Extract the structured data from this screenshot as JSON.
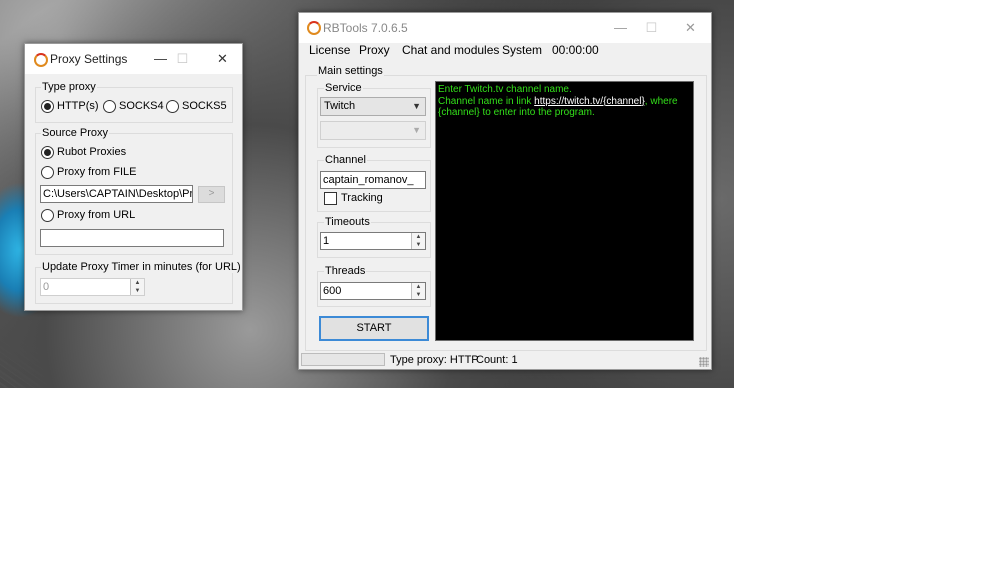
{
  "proxy_window": {
    "title": "Proxy Settings",
    "controls": {
      "minimize": "—",
      "maximize": "☐",
      "close": "✕"
    },
    "type_proxy": {
      "label": "Type proxy",
      "options": [
        "HTTP(s)",
        "SOCKS4",
        "SOCKS5"
      ],
      "selected": "HTTP(s)"
    },
    "source_proxy": {
      "label": "Source Proxy",
      "rubot_label": "Rubot Proxies",
      "file_label": "Proxy from FILE",
      "file_path": "C:\\Users\\CAPTAIN\\Desktop\\Proxy",
      "browse_label": ">",
      "url_label": "Proxy from URL",
      "url_value": "",
      "selected": "Rubot Proxies"
    },
    "update_timer": {
      "label": "Update Proxy Timer in minutes (for URL)",
      "value": "0"
    }
  },
  "rbtools_window": {
    "title": "RBTools 7.0.6.5",
    "controls": {
      "minimize": "—",
      "maximize": "☐",
      "close": "✕"
    },
    "menu": {
      "license": "License",
      "proxy": "Proxy",
      "chat": "Chat and modules",
      "system": "System",
      "timer": "00:00:00"
    },
    "main_settings_label": "Main settings",
    "service": {
      "label": "Service",
      "selected": "Twitch",
      "secondary": ""
    },
    "channel": {
      "label": "Channel",
      "value": "captain_romanov_",
      "tracking_label": "Tracking",
      "tracking_checked": false
    },
    "timeouts": {
      "label": "Timeouts",
      "value": "1"
    },
    "threads": {
      "label": "Threads",
      "value": "600"
    },
    "start_label": "START",
    "console": {
      "line1": "Enter Twitch.tv channel name.",
      "line2_prefix": "Channel name in link ",
      "line2_link": "https://twitch.tv/{channel}",
      "line2_suffix": ", where",
      "line3": "{channel} to enter into the program."
    },
    "status": {
      "progress": 0,
      "type_proxy": "Type proxy: HTTP",
      "count": "Count: 1"
    }
  },
  "colors": {
    "console_bg": "#000000",
    "console_text": "#33e01a",
    "start_border": "#3c8ad6",
    "app_icon": "#e08a1e"
  }
}
